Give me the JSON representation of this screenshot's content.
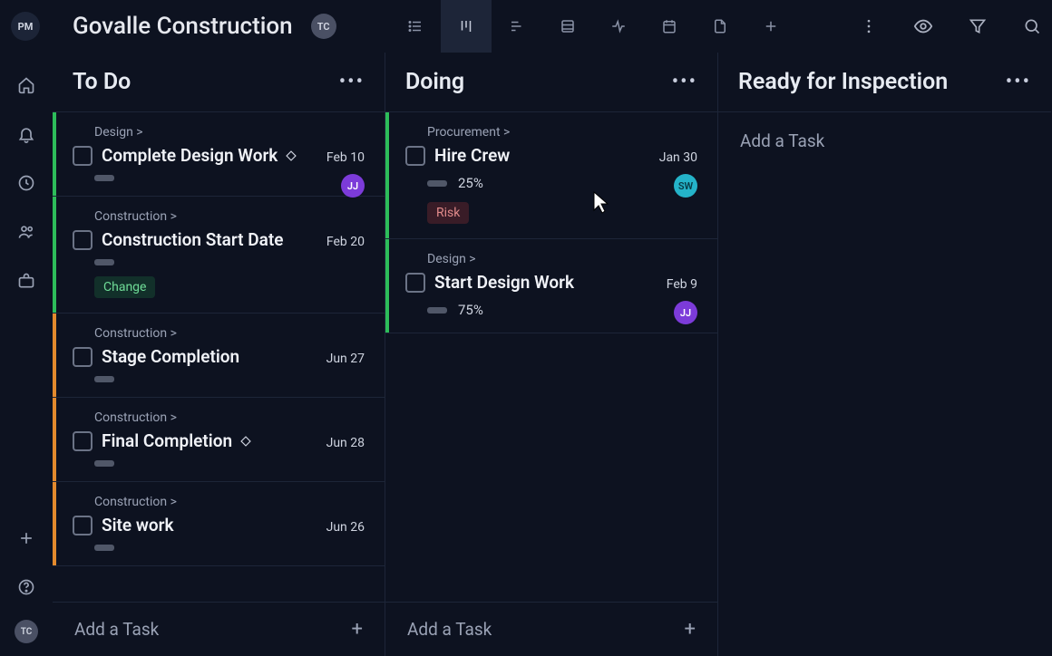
{
  "header": {
    "logo_text": "PM",
    "project_title": "Govalle Construction",
    "user_chip": "TC"
  },
  "columns": [
    {
      "title": "To Do",
      "add_label": "Add a Task",
      "cards": [
        {
          "breadcrumb": "Design >",
          "title": "Complete Design Work",
          "has_diamond": true,
          "date": "Feb 10",
          "stripe": "green",
          "avatar": {
            "text": "JJ",
            "cls": "purple"
          },
          "progress": null,
          "tag": null
        },
        {
          "breadcrumb": "Construction >",
          "title": "Construction Start Date",
          "has_diamond": false,
          "date": "Feb 20",
          "stripe": "green",
          "avatar": null,
          "progress": null,
          "tag": {
            "text": "Change",
            "cls": "change"
          }
        },
        {
          "breadcrumb": "Construction >",
          "title": "Stage Completion",
          "has_diamond": false,
          "date": "Jun 27",
          "stripe": "orange",
          "avatar": null,
          "progress": null,
          "tag": null
        },
        {
          "breadcrumb": "Construction >",
          "title": "Final Completion",
          "has_diamond": true,
          "date": "Jun 28",
          "stripe": "orange",
          "avatar": null,
          "progress": null,
          "tag": null
        },
        {
          "breadcrumb": "Construction >",
          "title": "Site work",
          "has_diamond": false,
          "date": "Jun 26",
          "stripe": "orange",
          "avatar": null,
          "progress": null,
          "tag": null
        }
      ]
    },
    {
      "title": "Doing",
      "add_label": "Add a Task",
      "cards": [
        {
          "breadcrumb": "Procurement >",
          "title": "Hire Crew",
          "has_diamond": false,
          "date": "Jan 30",
          "stripe": "green",
          "avatar": {
            "text": "SW",
            "cls": "cyan"
          },
          "progress": "25%",
          "tag": {
            "text": "Risk",
            "cls": "risk"
          }
        },
        {
          "breadcrumb": "Design >",
          "title": "Start Design Work",
          "has_diamond": false,
          "date": "Feb 9",
          "stripe": "green",
          "avatar": {
            "text": "JJ",
            "cls": "purple"
          },
          "progress": "75%",
          "tag": null
        }
      ]
    },
    {
      "title": "Ready for Inspection",
      "add_label": "Add a Task",
      "cards": []
    }
  ]
}
